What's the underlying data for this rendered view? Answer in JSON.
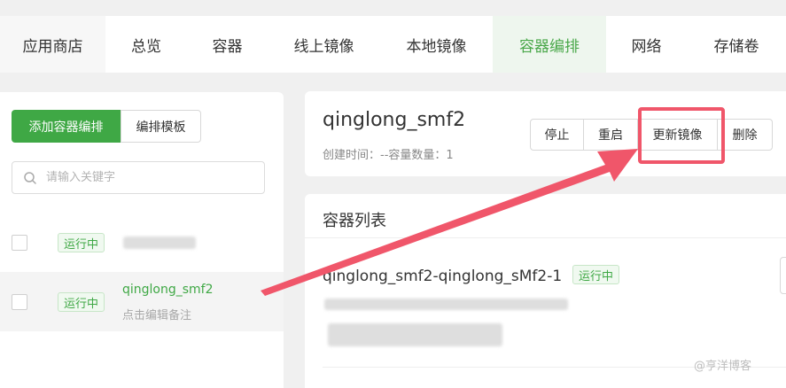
{
  "tabs": [
    {
      "label": "应用商店",
      "active": false
    },
    {
      "label": "总览",
      "active": false
    },
    {
      "label": "容器",
      "active": false
    },
    {
      "label": "线上镜像",
      "active": false
    },
    {
      "label": "本地镜像",
      "active": false
    },
    {
      "label": "容器编排",
      "active": true
    },
    {
      "label": "网络",
      "active": false
    },
    {
      "label": "存储卷",
      "active": false
    }
  ],
  "left": {
    "add_button": "添加容器编排",
    "template_button": "编排模板",
    "search_placeholder": "请输入关键字",
    "items": [
      {
        "status": "运行中",
        "name": "",
        "note": ""
      },
      {
        "status": "运行中",
        "name": "qinglong_smf2",
        "note": "点击编辑备注"
      }
    ]
  },
  "detail": {
    "title": "qinglong_smf2",
    "meta": "创建时间：--容量数量：1",
    "buttons": {
      "stop": "停止",
      "restart": "重启",
      "update_image": "更新镜像",
      "delete": "删除"
    }
  },
  "containers": {
    "header": "容器列表",
    "item": {
      "name": "qinglong_smf2-qinglong_sMf2-1",
      "status": "运行中"
    }
  },
  "watermark": "@亨洋博客",
  "colors": {
    "accent": "#3fa845",
    "highlight": "#f0566a"
  }
}
